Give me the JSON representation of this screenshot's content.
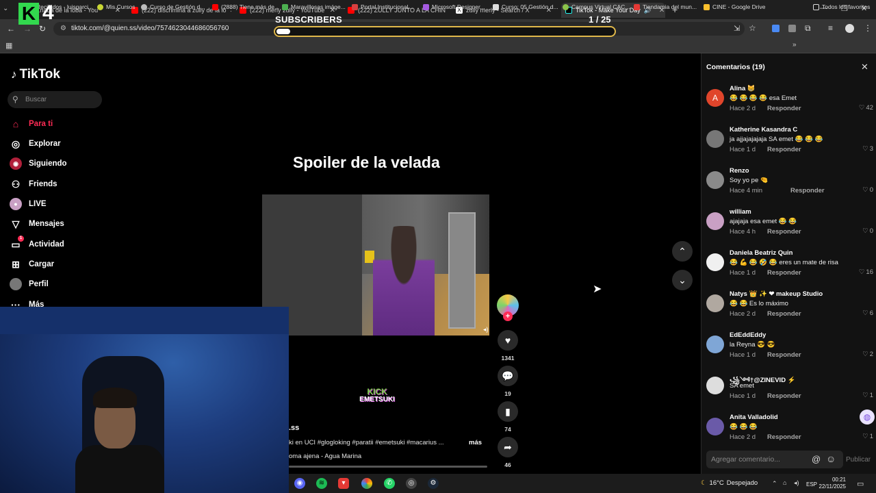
{
  "browser": {
    "tabs": [
      {
        "label": "(2...nada de la loba - You",
        "color": "#ff0000"
      },
      {
        "label": "(222) discrimina a zully de la lo",
        "color": "#ff0000"
      },
      {
        "label": "(222) merly zully - YouTube",
        "color": "#ff0000"
      },
      {
        "label": "(222) ZULLY JUNTO A LA CHIN",
        "color": "#ff0000"
      },
      {
        "label": "zully merly - Search / X",
        "color": "#ffffff"
      },
      {
        "label": "TikTok - Make Your Day",
        "color": "#25f4ee"
      }
    ],
    "url": "tiktok.com/@quien.ss/video/7574623044686056760",
    "bookmarks": [
      "Recibidos - luisgarci...",
      "Mis Cursos",
      "Curso de Gestión d...",
      "(2888) Tiene más de...",
      "Maravillosas imáge...",
      "Portal Institucional...",
      "Microsoft Designer...",
      "Curso: 05 Gestión d...",
      "Campus Virtual CAC...",
      "Tiendamia del mun...",
      "CINE - Google Drive",
      "Todos los favoritos"
    ]
  },
  "overlay": {
    "kick_number": "4",
    "subscribers_label": "SUBSCRIBERS",
    "subscribers_count": "1  / 25",
    "progress": 0.04
  },
  "tiktok": {
    "logo": "TikTok",
    "search_placeholder": "Buscar",
    "nav": [
      {
        "label": "Para ti",
        "icon": "home-icon"
      },
      {
        "label": "Explorar",
        "icon": "compass-icon"
      },
      {
        "label": "Siguiendo",
        "icon": "following-icon"
      },
      {
        "label": "Friends",
        "icon": "friends-icon"
      },
      {
        "label": "LIVE",
        "icon": "live-icon"
      },
      {
        "label": "Mensajes",
        "icon": "message-icon"
      },
      {
        "label": "Actividad",
        "icon": "activity-icon"
      },
      {
        "label": "Cargar",
        "icon": "upload-icon"
      },
      {
        "label": "Perfil",
        "icon": "profile-icon"
      },
      {
        "label": "Más",
        "icon": "more-icon"
      }
    ],
    "video": {
      "title": "Spoiler de la velada",
      "watermark_top": "KICK",
      "watermark_bottom": "EMETSUKI",
      "author": ".ss",
      "description": "ki en UCI #glogloking #paratii #emetsuki #macarius ...",
      "more": "más",
      "music": "oma ajena - Agua Marina",
      "likes": "1341",
      "comments": "19",
      "saves": "74",
      "shares": "46"
    },
    "comments_panel": {
      "title": "Comentarios (19)",
      "reply_label": "Responder",
      "input_placeholder": "Agregar comentario...",
      "post_label": "Publicar",
      "items": [
        {
          "name": "Alina 😸",
          "text": "😂 😂 😂 😂 esa Emet",
          "time": "Hace 2 d",
          "likes": "42",
          "color": "#e0452b",
          "initial": "A"
        },
        {
          "name": "Katherine Kasandra C",
          "text": "ja ajjajajajaja SA emet 😂 😂 😂",
          "time": "Hace 1 d",
          "likes": "3",
          "color": "#777777",
          "initial": ""
        },
        {
          "name": "Renzo",
          "text": "Soy yo pe 🤏",
          "time": "Hace 4 min",
          "likes": "0",
          "color": "#8a8a8a",
          "initial": ""
        },
        {
          "name": "william",
          "text": "ajajaja esa emet 😂 😂",
          "time": "Hace 4 h",
          "likes": "0",
          "color": "#c9a0c4",
          "initial": ""
        },
        {
          "name": "Daniela Beatriz Quin",
          "text": "😂 💪 😂 🤣 😂 eres un mate de risa",
          "time": "Hace 1 d",
          "likes": "16",
          "color": "#f0f0f0",
          "initial": ""
        },
        {
          "name": "Natys 👑 ✨ ❤ makeup Studio",
          "text": "😂 😂 Es lo máximo",
          "time": "Hace 2 d",
          "likes": "6",
          "color": "#b0a8a0",
          "initial": ""
        },
        {
          "name": "EdEddEddy",
          "text": "la Reyna 😎 😎",
          "time": "Hace 1 d",
          "likes": "2",
          "color": "#7fa6d6",
          "initial": ""
        },
        {
          "name": "꧁༺†@ZINEVID ⚡",
          "text": "SA emet",
          "time": "Hace 1 d",
          "likes": "1",
          "color": "#dddddd",
          "initial": ""
        },
        {
          "name": "Anita Valladolid",
          "text": "😂 😂 😂",
          "time": "Hace 2 d",
          "likes": "1",
          "color": "#6a5aa8",
          "initial": ""
        }
      ]
    }
  },
  "taskbar": {
    "temperature": "16°C",
    "weather": "Despejado",
    "lang": "ESP",
    "time": "00:21",
    "date": "22/11/2025"
  }
}
